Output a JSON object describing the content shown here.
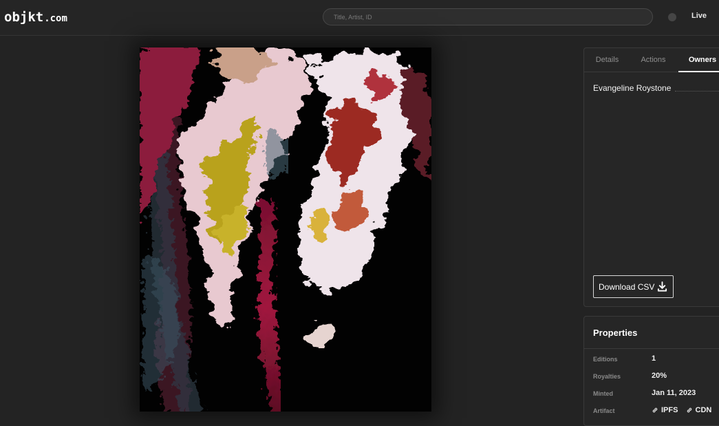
{
  "header": {
    "logo_main": "objkt",
    "logo_tld": ".com",
    "search_placeholder": "Title, Artist, ID",
    "live_label": "Live"
  },
  "tabs": [
    {
      "label": "Details",
      "active": false
    },
    {
      "label": "Actions",
      "active": false
    },
    {
      "label": "Owners",
      "active": true
    }
  ],
  "owners": {
    "list": [
      {
        "name": "Evangeline Roystone"
      }
    ],
    "download_label": "Download CSV"
  },
  "properties": {
    "title": "Properties",
    "editions": {
      "label": "Editions",
      "value": "1"
    },
    "royalties": {
      "label": "Royalties",
      "value": "20%"
    },
    "minted": {
      "label": "Minted",
      "value": "Jan 11, 2023"
    },
    "artifact": {
      "label": "Artifact",
      "links": [
        {
          "label": "IPFS",
          "icon": "link-icon"
        },
        {
          "label": "CDN",
          "icon": "link-icon"
        }
      ]
    }
  },
  "colors": {
    "background": "#232323",
    "panel": "#262626",
    "border": "#3a3a3a",
    "text": "#ffffff",
    "muted": "#8a8a8a"
  }
}
